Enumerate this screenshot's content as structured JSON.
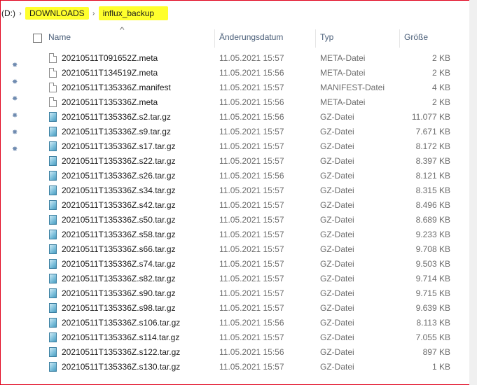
{
  "breadcrumb": {
    "drive": "(D:)",
    "separator": "›",
    "folder1": "DOWNLOADS",
    "folder2": "influx_backup"
  },
  "columns": {
    "name": "Name",
    "date": "Änderungsdatum",
    "type": "Typ",
    "size": "Größe"
  },
  "icons": {
    "sort": "sort-ascending-icon",
    "pin": "pin-icon",
    "doc": "document-file-icon",
    "archive": "archive-file-icon"
  },
  "files": [
    {
      "name": "20210511T091652Z.meta",
      "date": "11.05.2021 15:57",
      "type": "META-Datei",
      "size": "2 KB",
      "icon": "doc"
    },
    {
      "name": "20210511T134519Z.meta",
      "date": "11.05.2021 15:56",
      "type": "META-Datei",
      "size": "2 KB",
      "icon": "doc"
    },
    {
      "name": "20210511T135336Z.manifest",
      "date": "11.05.2021 15:57",
      "type": "MANIFEST-Datei",
      "size": "4 KB",
      "icon": "doc"
    },
    {
      "name": "20210511T135336Z.meta",
      "date": "11.05.2021 15:56",
      "type": "META-Datei",
      "size": "2 KB",
      "icon": "doc"
    },
    {
      "name": "20210511T135336Z.s2.tar.gz",
      "date": "11.05.2021 15:56",
      "type": "GZ-Datei",
      "size": "11.077 KB",
      "icon": "gz"
    },
    {
      "name": "20210511T135336Z.s9.tar.gz",
      "date": "11.05.2021 15:57",
      "type": "GZ-Datei",
      "size": "7.671 KB",
      "icon": "gz"
    },
    {
      "name": "20210511T135336Z.s17.tar.gz",
      "date": "11.05.2021 15:57",
      "type": "GZ-Datei",
      "size": "8.172 KB",
      "icon": "gz"
    },
    {
      "name": "20210511T135336Z.s22.tar.gz",
      "date": "11.05.2021 15:57",
      "type": "GZ-Datei",
      "size": "8.397 KB",
      "icon": "gz"
    },
    {
      "name": "20210511T135336Z.s26.tar.gz",
      "date": "11.05.2021 15:56",
      "type": "GZ-Datei",
      "size": "8.121 KB",
      "icon": "gz"
    },
    {
      "name": "20210511T135336Z.s34.tar.gz",
      "date": "11.05.2021 15:57",
      "type": "GZ-Datei",
      "size": "8.315 KB",
      "icon": "gz"
    },
    {
      "name": "20210511T135336Z.s42.tar.gz",
      "date": "11.05.2021 15:57",
      "type": "GZ-Datei",
      "size": "8.496 KB",
      "icon": "gz"
    },
    {
      "name": "20210511T135336Z.s50.tar.gz",
      "date": "11.05.2021 15:57",
      "type": "GZ-Datei",
      "size": "8.689 KB",
      "icon": "gz"
    },
    {
      "name": "20210511T135336Z.s58.tar.gz",
      "date": "11.05.2021 15:57",
      "type": "GZ-Datei",
      "size": "9.233 KB",
      "icon": "gz"
    },
    {
      "name": "20210511T135336Z.s66.tar.gz",
      "date": "11.05.2021 15:57",
      "type": "GZ-Datei",
      "size": "9.708 KB",
      "icon": "gz"
    },
    {
      "name": "20210511T135336Z.s74.tar.gz",
      "date": "11.05.2021 15:57",
      "type": "GZ-Datei",
      "size": "9.503 KB",
      "icon": "gz"
    },
    {
      "name": "20210511T135336Z.s82.tar.gz",
      "date": "11.05.2021 15:57",
      "type": "GZ-Datei",
      "size": "9.714 KB",
      "icon": "gz"
    },
    {
      "name": "20210511T135336Z.s90.tar.gz",
      "date": "11.05.2021 15:57",
      "type": "GZ-Datei",
      "size": "9.715 KB",
      "icon": "gz"
    },
    {
      "name": "20210511T135336Z.s98.tar.gz",
      "date": "11.05.2021 15:57",
      "type": "GZ-Datei",
      "size": "9.639 KB",
      "icon": "gz"
    },
    {
      "name": "20210511T135336Z.s106.tar.gz",
      "date": "11.05.2021 15:56",
      "type": "GZ-Datei",
      "size": "8.113 KB",
      "icon": "gz"
    },
    {
      "name": "20210511T135336Z.s114.tar.gz",
      "date": "11.05.2021 15:57",
      "type": "GZ-Datei",
      "size": "7.055 KB",
      "icon": "gz"
    },
    {
      "name": "20210511T135336Z.s122.tar.gz",
      "date": "11.05.2021 15:56",
      "type": "GZ-Datei",
      "size": "897 KB",
      "icon": "gz"
    },
    {
      "name": "20210511T135336Z.s130.tar.gz",
      "date": "11.05.2021 15:57",
      "type": "GZ-Datei",
      "size": "1 KB",
      "icon": "gz"
    }
  ]
}
